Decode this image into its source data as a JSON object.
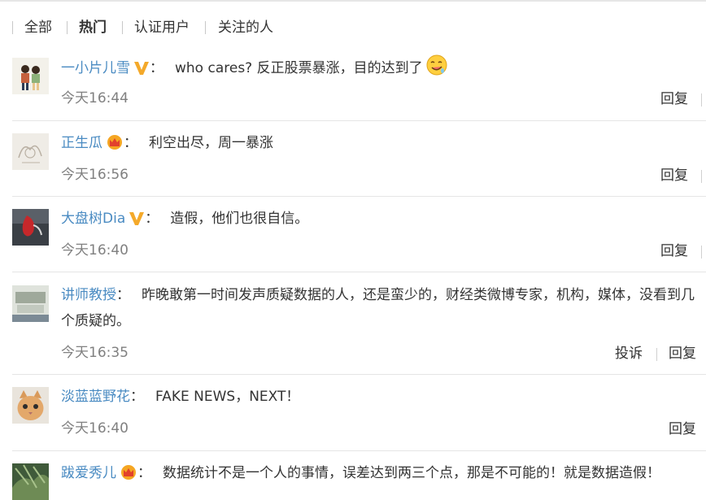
{
  "filters": [
    {
      "label": "全部",
      "active": false
    },
    {
      "label": "热门",
      "active": true
    },
    {
      "label": "认证用户",
      "active": false
    },
    {
      "label": "关注的人",
      "active": false
    }
  ],
  "comments": [
    {
      "user": "一小片儿雪",
      "badge": "v-icon",
      "colon": "：",
      "text": "who cares? 反正股票暴涨，目的达到了",
      "emoji": "drooling-face-icon",
      "time": "今天16:44",
      "actions": [
        "回复"
      ]
    },
    {
      "user": "正生瓜",
      "badge": "crown-icon",
      "colon": "：",
      "text": "利空出尽，周一暴涨",
      "time": "今天16:56",
      "actions": [
        "回复"
      ]
    },
    {
      "user": "大盘树Dia",
      "badge": "v-icon",
      "colon": "：",
      "text": "造假，他们也很自信。",
      "time": "今天16:40",
      "actions": [
        "回复"
      ]
    },
    {
      "user": "讲师教授",
      "badge": "",
      "colon": "：",
      "text": "昨晚敢第一时间发声质疑数据的人，还是蛮少的，财经类微博专家，机构，媒体，没看到几个质疑的。",
      "time": "今天16:35",
      "actions": [
        "投诉",
        "回复"
      ]
    },
    {
      "user": "淡蓝蓝野花",
      "badge": "",
      "colon": "：",
      "text": "FAKE NEWS，NEXT！",
      "time": "今天16:40",
      "actions": [
        "回复"
      ]
    },
    {
      "user": "跋爱秀儿",
      "badge": "crown-icon",
      "colon": "：",
      "text": "数据统计不是一个人的事情，误差达到两三个点，那是不可能的！就是数据造假！",
      "time": "",
      "actions": []
    }
  ],
  "colors": {
    "username": "#4a8bc2",
    "badge_gold": "#f4a92a",
    "time": "#808080",
    "divider": "#e5e5e5"
  }
}
